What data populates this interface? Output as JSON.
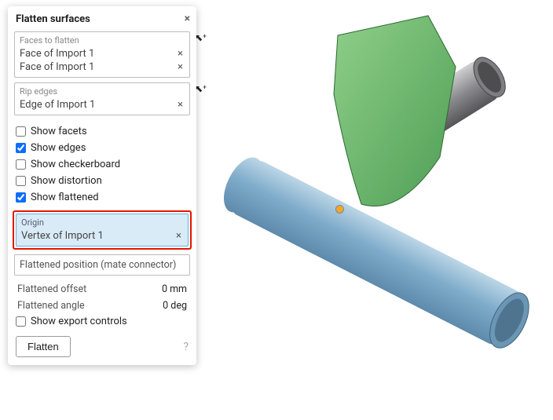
{
  "panel": {
    "title": "Flatten surfaces",
    "faces_group_label": "Faces to flatten",
    "faces": [
      {
        "label": "Face of Import 1"
      },
      {
        "label": "Face of Import 1"
      }
    ],
    "rip_group_label": "Rip edges",
    "rip_edges": [
      {
        "label": "Edge of Import 1"
      }
    ],
    "checks": {
      "show_facets": "Show facets",
      "show_edges": "Show edges",
      "show_checkerboard": "Show checkerboard",
      "show_distortion": "Show distortion",
      "show_flattened": "Show flattened"
    },
    "check_values": {
      "show_facets": false,
      "show_edges": true,
      "show_checkerboard": false,
      "show_distortion": false,
      "show_flattened": true
    },
    "origin": {
      "label": "Origin",
      "value": "Vertex of Import 1"
    },
    "mate_label": "Flattened position (mate connector)",
    "offset": {
      "label": "Flattened offset",
      "value": "0 mm"
    },
    "angle": {
      "label": "Flattened angle",
      "value": "0 deg"
    },
    "show_export_controls": "Show export controls",
    "show_export_controls_checked": false,
    "flatten_button": "Flatten",
    "glyphs": {
      "close": "×",
      "clear": "×",
      "help": "?",
      "cursor_plus": "⬉⁺"
    }
  },
  "model": {
    "description": "3D view of two intersecting cylindrical tubes with an unfolded green surface",
    "origin_marker": "vertex-marker"
  }
}
